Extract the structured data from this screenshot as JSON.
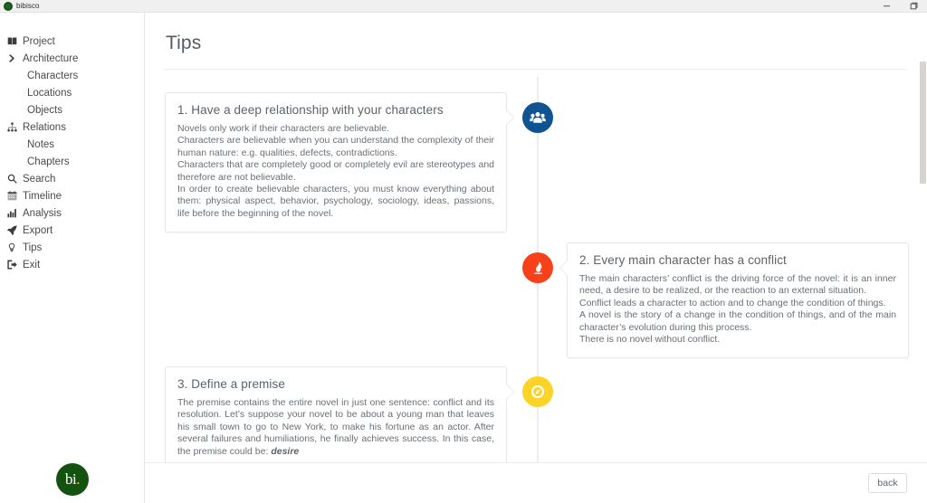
{
  "window": {
    "app_title": "bibisco",
    "logo_icon": "bibisco-logo-icon",
    "minimize_label": "minimize",
    "maximize_label": "maximize",
    "minimize_icon": "minimize-icon",
    "maximize_icon": "maximize-icon"
  },
  "sidebar": {
    "items": [
      {
        "label": "Project",
        "icon": "book-icon",
        "sub": false
      },
      {
        "label": "Architecture",
        "icon": "chevron-right-icon",
        "sub": false
      },
      {
        "label": "Characters",
        "icon": "",
        "sub": true
      },
      {
        "label": "Locations",
        "icon": "",
        "sub": true
      },
      {
        "label": "Objects",
        "icon": "",
        "sub": true
      },
      {
        "label": "Relations",
        "icon": "sitemap-icon",
        "sub": false
      },
      {
        "label": "Notes",
        "icon": "",
        "sub": true
      },
      {
        "label": "Chapters",
        "icon": "",
        "sub": true
      },
      {
        "label": "Search",
        "icon": "search-icon",
        "sub": false
      },
      {
        "label": "Timeline",
        "icon": "calendar-icon",
        "sub": false
      },
      {
        "label": "Analysis",
        "icon": "bar-chart-icon",
        "sub": false
      },
      {
        "label": "Export",
        "icon": "rocket-icon",
        "sub": false
      },
      {
        "label": "Tips",
        "icon": "lightbulb-icon",
        "sub": false
      },
      {
        "label": "Exit",
        "icon": "sign-out-icon",
        "sub": false
      }
    ],
    "logo_text": "bi",
    "logo_accent_color": "#f0d020",
    "logo_bg_color": "#14520f"
  },
  "main": {
    "page_title": "Tips"
  },
  "tips": [
    {
      "id": "tip-1",
      "number": "1",
      "title": "1. Have a deep relationship with your characters",
      "body": "Novels only work if their characters are believable.\nCharacters are believable when you can understand the complexity of their human nature: e.g. qualities, defects, contradictions.\nCharacters that are completely good or completely evil are stereotypes and therefore are not believable.\nIn order to create believable characters, you must know everything about them: physical aspect, behavior, psychology, sociology, ideas, passions, life before the beginning of the novel.",
      "badge_icon": "users-icon",
      "badge_color": "#0f5392",
      "side": "left"
    },
    {
      "id": "tip-2",
      "number": "2",
      "title": "2. Every main character has a conflict",
      "body": "The main characters’ conflict is the driving force of the novel: it is an inner need, a desire to be realized, or the reaction to an external situation.\nConflict leads a character to action and to change the condition of things.\nA novel is the story of a change in the condition of things, and of the main character’s evolution during this process.\nThere is no novel without conflict.",
      "badge_icon": "fire-icon",
      "badge_color": "#f8411b",
      "side": "right"
    },
    {
      "id": "tip-3",
      "number": "3",
      "title": "3. Define a premise",
      "body_part1": "The premise contains the entire novel in just one sentence: conflict and its resolution.\nLet’s suppose your novel to be about a young man that leaves his small town to go to New York, to make his fortune as an actor. After several failures and humiliations, he finally achieves success. In this case, the premise could be: ",
      "body_italic": "desire",
      "badge_icon": "compass-icon",
      "badge_color": "#fcd326",
      "side": "left"
    }
  ],
  "footer": {
    "back_label": "back"
  },
  "colors": {
    "accent_blue": "#0f5392",
    "accent_orange": "#f8411b",
    "accent_yellow": "#fcd326",
    "brand_green": "#14520f",
    "text_muted": "#6a6f74",
    "border": "#e6e6e6"
  }
}
